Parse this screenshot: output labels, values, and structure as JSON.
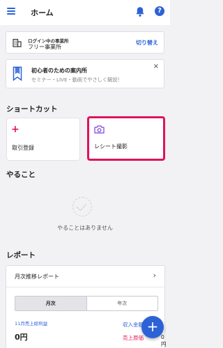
{
  "header": {
    "title": "ホーム",
    "help_label": "?"
  },
  "business": {
    "label": "ログイン中の事業所",
    "name": "フリー事業所",
    "switch_label": "切り替え"
  },
  "guide": {
    "title": "初心者のための案内所",
    "subtitle": "セミナー・LIVE・動画でやさしく解説！",
    "close_label": "×"
  },
  "shortcuts": {
    "title": "ショートカット",
    "deal": {
      "icon": "plus-icon",
      "icon_glyph": "+",
      "label": "取引登録"
    },
    "receipt": {
      "icon": "camera-icon",
      "label": "レシート撮影"
    }
  },
  "todo": {
    "title": "やること",
    "empty_message": "やることはありません"
  },
  "report": {
    "title": "レポート",
    "monthly_report_label": "月次推移レポート",
    "chevron": "›",
    "tabs": [
      "月次",
      "年次"
    ],
    "profit_label": "11月売上総利益",
    "profit_value": "0円",
    "income_label": "収入金額",
    "cost_label": "売上原価",
    "cost_value": "0円"
  },
  "fab": {
    "label": "+"
  },
  "colors": {
    "primary": "#2d62d6",
    "accent": "#e0135b",
    "background": "#f2f2f4"
  }
}
